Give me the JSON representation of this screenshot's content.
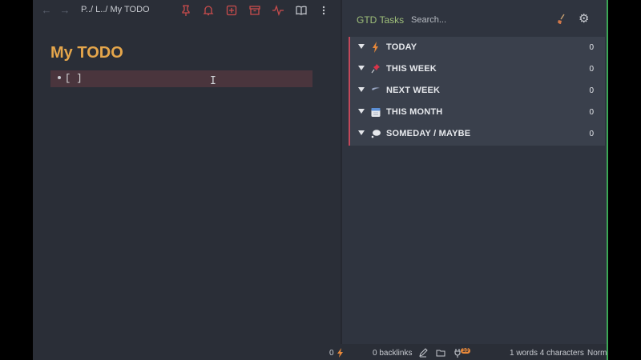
{
  "editor": {
    "breadcrumb": "P../ L../ My TODO",
    "title": "My TODO",
    "line_text": "[ ]",
    "toolbar_icons": [
      "pin-icon",
      "bell-icon",
      "add-box-icon",
      "archive-icon",
      "activity-icon",
      "book-open-icon",
      "more-vertical-icon"
    ]
  },
  "gtd": {
    "title": "GTD Tasks",
    "search_placeholder": "Search...",
    "sections": [
      {
        "label": "TODAY",
        "count": "0",
        "icon": "lightning-icon"
      },
      {
        "label": "THIS WEEK",
        "count": "0",
        "icon": "pushpin-icon"
      },
      {
        "label": "NEXT WEEK",
        "count": "0",
        "icon": "feather-icon"
      },
      {
        "label": "THIS MONTH",
        "count": "0",
        "icon": "calendar-icon"
      },
      {
        "label": "SOMEDAY / MAYBE",
        "count": "0",
        "icon": "thought-bubble-icon"
      }
    ]
  },
  "status": {
    "tasks_count": "0",
    "backlinks": "0 backlinks",
    "plugin_badge": "10",
    "word_count": "1 words 4 characters",
    "mode": "Normal Mode"
  },
  "colors": {
    "accent_red": "#c2485a",
    "title_orange": "#e5a64b",
    "panel_title_green": "#9fbf7a"
  }
}
